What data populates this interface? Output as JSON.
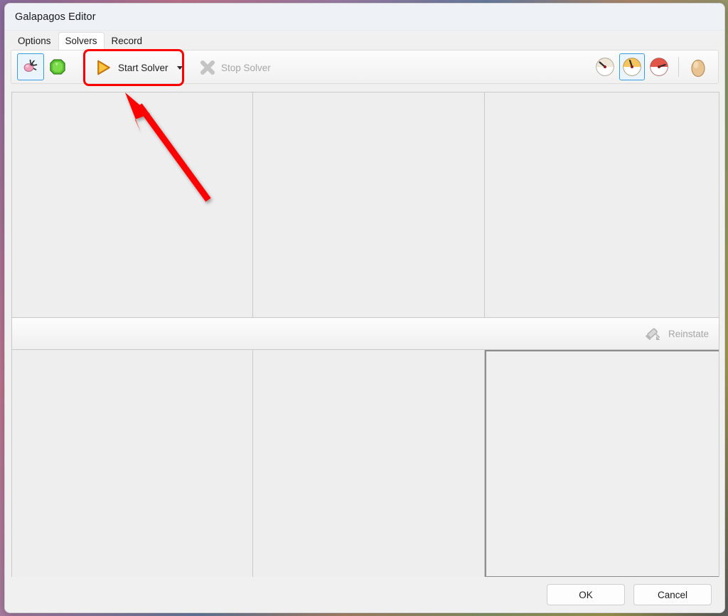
{
  "window": {
    "title": "Galapagos Editor"
  },
  "tabs": [
    {
      "label": "Options",
      "active": false
    },
    {
      "label": "Solvers",
      "active": true
    },
    {
      "label": "Record",
      "active": false
    }
  ],
  "toolbar": {
    "left_icons": [
      {
        "name": "beetle-icon",
        "selected": true
      },
      {
        "name": "green-gem-icon",
        "selected": false
      }
    ],
    "start_solver_label": "Start Solver",
    "start_solver_icon": "play-triangle-icon",
    "start_solver_dropdown_icon": "chevron-down-icon",
    "stop_solver_label": "Stop Solver",
    "stop_solver_icon": "x-cross-icon",
    "stop_solver_disabled": true,
    "speed_icons": [
      {
        "name": "gauge-slow-icon",
        "selected": false
      },
      {
        "name": "gauge-medium-icon",
        "selected": true
      },
      {
        "name": "gauge-fast-icon",
        "selected": false
      }
    ],
    "egg_icon": "egg-icon"
  },
  "midbar": {
    "reinstate_label": "Reinstate",
    "reinstate_icon": "syringe-icon",
    "reinstate_disabled": true
  },
  "footer": {
    "ok_label": "OK",
    "cancel_label": "Cancel"
  },
  "annotation": {
    "type": "arrow",
    "color": "#ff0000",
    "points_to": "start-solver-button"
  },
  "colors": {
    "highlight_ring": "#ff0000",
    "selection_border": "#3c9ade",
    "window_bg": "#f0f0f0",
    "panel_bg": "#eeeeee",
    "disabled_text": "#a6a6a6"
  }
}
